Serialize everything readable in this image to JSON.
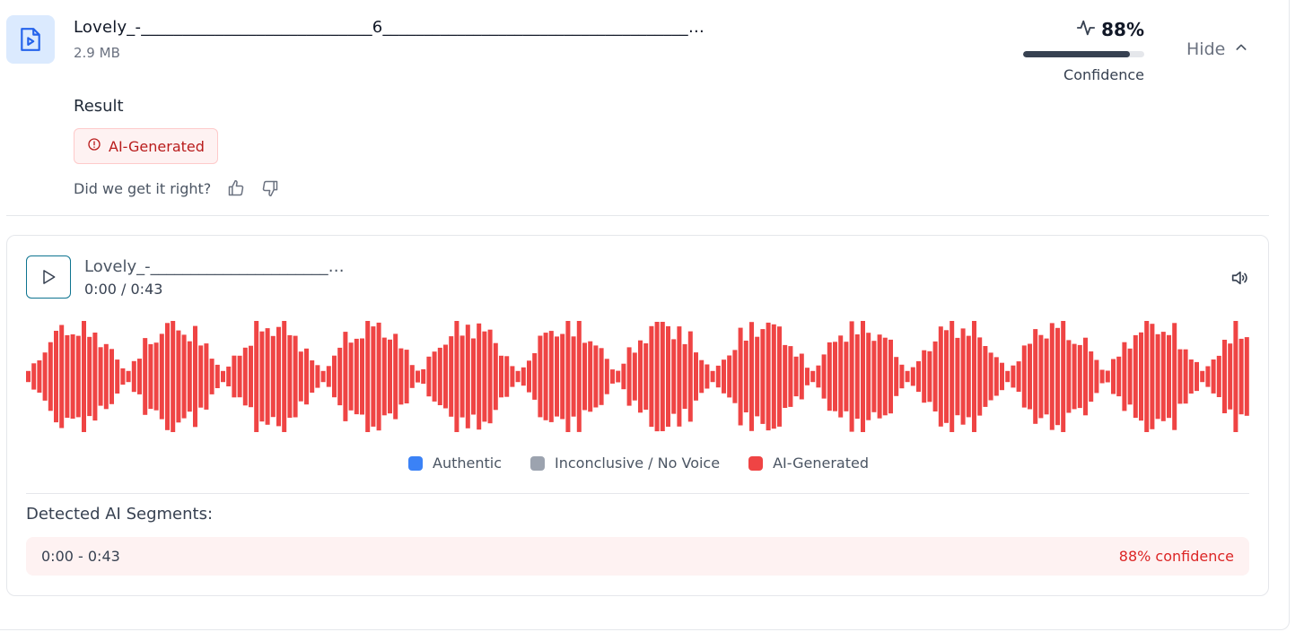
{
  "file": {
    "name": "Lovely_-____________________________6_____________________________________…",
    "size": "2.9 MB",
    "icon": "video-file-icon"
  },
  "confidence": {
    "percent_label": "88%",
    "value": 0.88,
    "label": "Confidence"
  },
  "toggle": {
    "label": "Hide"
  },
  "result": {
    "heading": "Result",
    "badge": "AI-Generated",
    "feedback_prompt": "Did we get it right?"
  },
  "player": {
    "title": "Lovely_-______________________…",
    "time": "0:00 / 0:43",
    "waveform_color": "#ef4444"
  },
  "legend": [
    {
      "label": "Authentic",
      "color": "#3b82f6"
    },
    {
      "label": "Inconclusive / No Voice",
      "color": "#9ca3af"
    },
    {
      "label": "AI-Generated",
      "color": "#ef4444"
    }
  ],
  "segments": {
    "heading": "Detected AI Segments:",
    "items": [
      {
        "range": "0:00 - 0:43",
        "confidence": "88% confidence"
      }
    ]
  }
}
